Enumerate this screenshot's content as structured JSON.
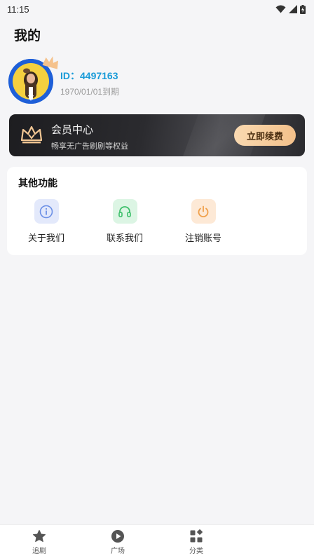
{
  "status_bar": {
    "time": "11:15",
    "icons": [
      "wifi-icon",
      "signal-icon",
      "battery-icon"
    ]
  },
  "page": {
    "title": "我的"
  },
  "profile": {
    "id_text": "ID：4497163",
    "expire_text": "1970/01/01到期",
    "avatar_icon": "avatar-image",
    "badge_icon": "crown-icon"
  },
  "vip": {
    "title": "会员中心",
    "subtitle": "畅享无广告刷剧等权益",
    "button_label": "立即续费",
    "icon": "vip-crown-icon"
  },
  "functions": {
    "title": "其他功能",
    "items": [
      {
        "label": "关于我们",
        "icon": "info-icon",
        "color": "#6b8fe6",
        "bg": "#e3e9fb"
      },
      {
        "label": "联系我们",
        "icon": "headset-icon",
        "color": "#3cbf6a",
        "bg": "#dcf5e4"
      },
      {
        "label": "注销账号",
        "icon": "power-icon",
        "color": "#f0a04b",
        "bg": "#fde9d6"
      }
    ]
  },
  "bottom_nav": {
    "items": [
      {
        "label": "追剧",
        "icon": "star-icon"
      },
      {
        "label": "广场",
        "icon": "play-icon"
      },
      {
        "label": "分类",
        "icon": "grid-icon"
      }
    ]
  },
  "colors": {
    "accent_id": "#1a9bd8",
    "vip_button": "#f3c08a",
    "background": "#f5f5f7"
  }
}
